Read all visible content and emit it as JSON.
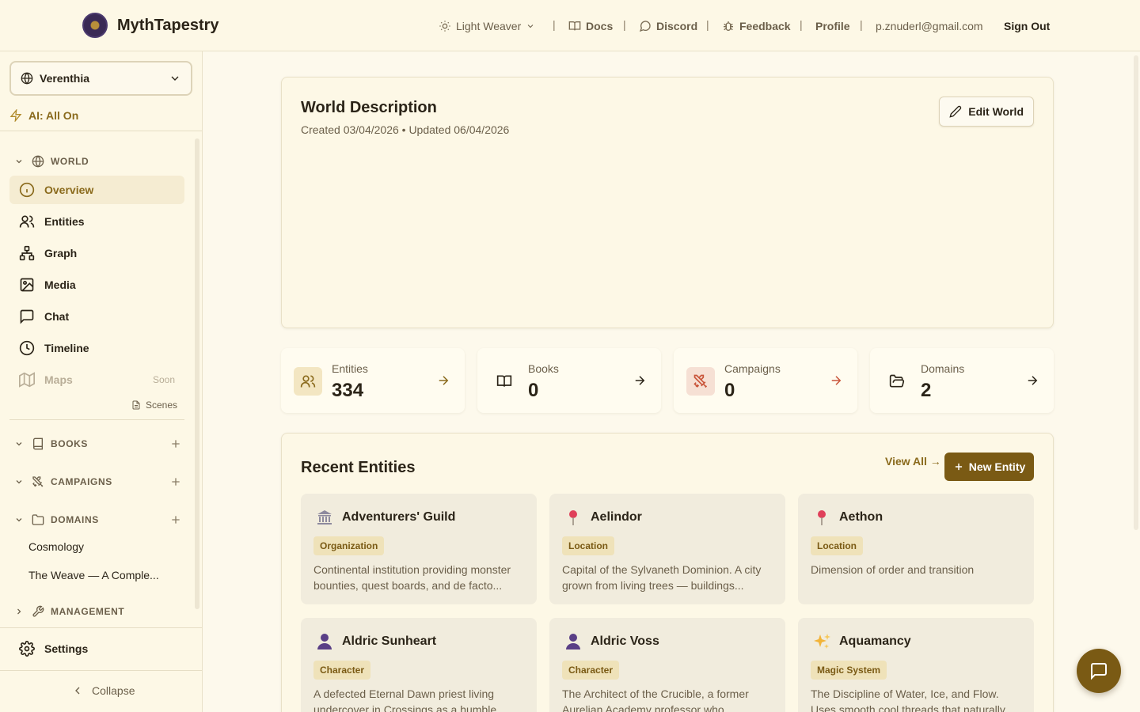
{
  "header": {
    "brand": "MythTapestry",
    "theme": "Light Weaver",
    "docs": "Docs",
    "discord": "Discord",
    "feedback": "Feedback",
    "profile": "Profile",
    "email": "p.znuderl@gmail.com",
    "sign_out": "Sign Out",
    "separator": "|"
  },
  "sidebar": {
    "world": "Verenthia",
    "ai": "AI: All On",
    "world_section": "WORLD",
    "items": {
      "overview": "Overview",
      "entities": "Entities",
      "graph": "Graph",
      "media": "Media",
      "chat": "Chat",
      "timeline": "Timeline",
      "maps": "Maps",
      "maps_badge": "Soon",
      "scenes": "Scenes"
    },
    "books": "BOOKS",
    "campaigns": "CAMPAIGNS",
    "domains": "DOMAINS",
    "domain_items": [
      "Cosmology",
      "The Weave — A Comple..."
    ],
    "management": "MANAGEMENT",
    "settings": "Settings",
    "collapse": "Collapse"
  },
  "world_description": {
    "title": "World Description",
    "meta": "Created 03/04/2026 • Updated 06/04/2026",
    "edit": "Edit World"
  },
  "stats": [
    {
      "label": "Entities",
      "value": "334"
    },
    {
      "label": "Books",
      "value": "0"
    },
    {
      "label": "Campaigns",
      "value": "0"
    },
    {
      "label": "Domains",
      "value": "2"
    }
  ],
  "recent": {
    "title": "Recent Entities",
    "view_all": "View All →",
    "new_entity": "New Entity",
    "entities": [
      {
        "name": "Adventurers' Guild",
        "type": "Organization",
        "desc": "Continental institution providing monster bounties, quest boards, and de facto...",
        "icon": "bank-icon"
      },
      {
        "name": "Aelindor",
        "type": "Location",
        "desc": "Capital of the Sylvaneth Dominion. A city grown from living trees — buildings...",
        "icon": "pin-icon"
      },
      {
        "name": "Aethon",
        "type": "Location",
        "desc": "Dimension of order and transition",
        "icon": "pin-icon"
      },
      {
        "name": "Aldric Sunheart",
        "type": "Character",
        "desc": "A defected Eternal Dawn priest living undercover in Crossings as a humble...",
        "icon": "person-icon"
      },
      {
        "name": "Aldric Voss",
        "type": "Character",
        "desc": "The Architect of the Crucible, a former Aurelian Academy professor who...",
        "icon": "person-icon"
      },
      {
        "name": "Aquamancy",
        "type": "Magic System",
        "desc": "The Discipline of Water, Ice, and Flow. Uses smooth cool threads that naturally seek...",
        "icon": "sparkles-icon"
      }
    ]
  },
  "colors": {
    "accent": "#7a5a14",
    "background": "#fdf9ec",
    "active_nav": "#f5ecd2"
  }
}
